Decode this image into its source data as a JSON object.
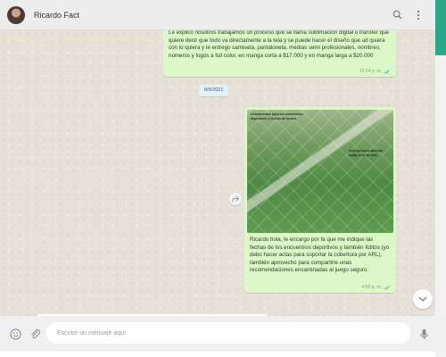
{
  "header": {
    "contact_name": "Ricardo Fact",
    "icons": [
      "search-icon",
      "menu-dots-icon"
    ]
  },
  "messages": [
    {
      "type": "outgoing-text",
      "text": "Le explico nosotros trabajamos un proceso que se llama sublimación digital o transfer que quiere decir que todo va directamente a la tela y se puede hacer el diseño que ud quiera con lo quiera y le entrego camiseta, pantaloneta, medias semi profesionales, nombres, números y logos a full color. en manga corta a $17.000 y en manga larga a $20.000",
      "time": "10:14 p. m."
    },
    {
      "type": "date-separator",
      "text": "8/6/2021"
    },
    {
      "type": "outgoing-image",
      "image_text_left": "Lineamientos para los encuentros deportivos y fechas de torneo",
      "image_text_right": "Inscripciones abiertas hasta el fin de mes",
      "text": "Ricardo hola, le encargo por fa que me indique las fechas de los encuentros deportivos y también fotitos (yo debo hacer actas para soportar la cobertura por ARL), también aprovecho para compartirle unas recomendaciones encaminadas al juego seguro.",
      "time": "4:55 p. m."
    }
  ],
  "composer": {
    "placeholder": "Escribe un mensaje aquí",
    "icons": [
      "emoji-icon",
      "attach-icon",
      "microphone-icon"
    ]
  },
  "colors": {
    "outgoing_bubble": "#dcf8c6",
    "chat_background": "#e6e1d7",
    "accent": "#2aa889"
  }
}
